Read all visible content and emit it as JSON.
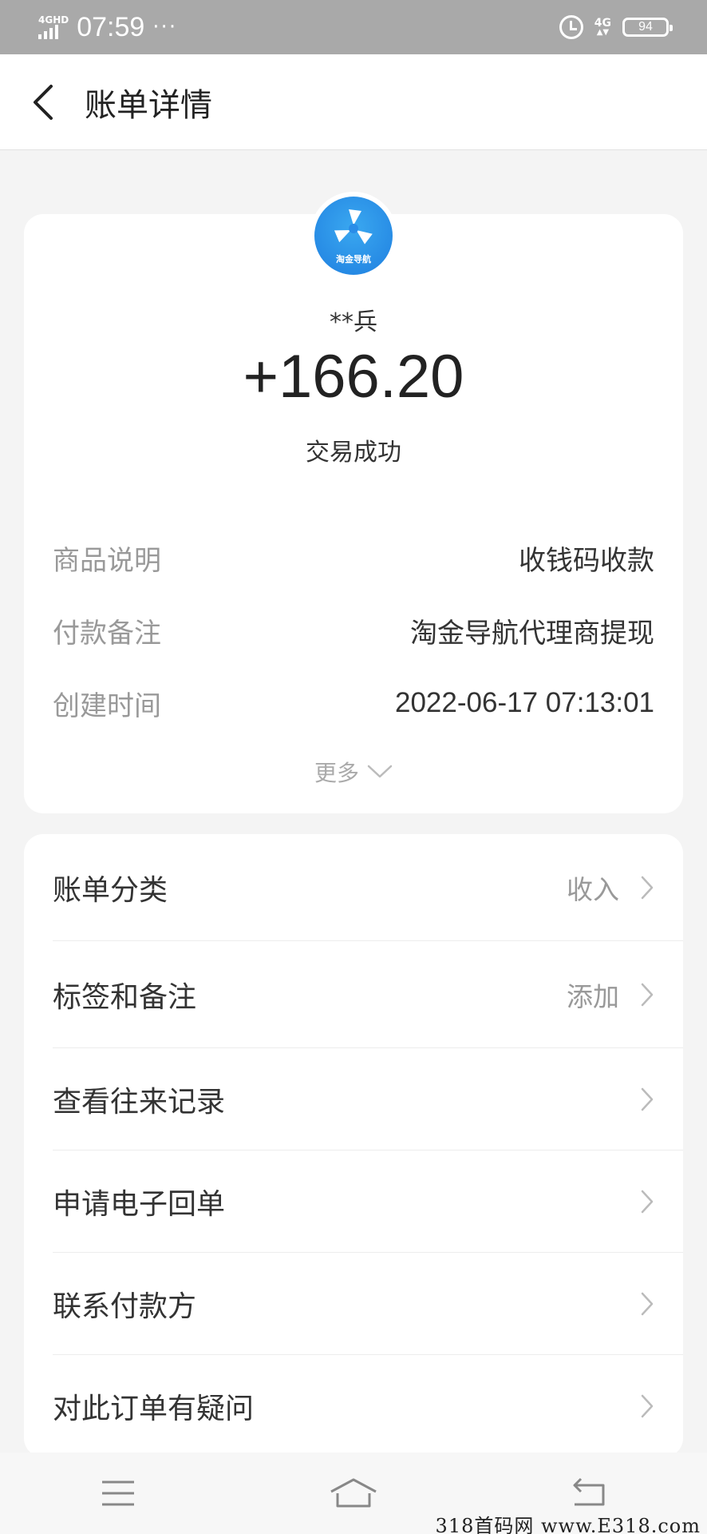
{
  "status_bar": {
    "network_label": "4GHD",
    "time": "07:59",
    "more": "···",
    "network_right": "4G",
    "battery": "94"
  },
  "header": {
    "title": "账单详情"
  },
  "transaction": {
    "merchant_logo_text": "淘金导航",
    "payer": "**兵",
    "amount": "+166.20",
    "status": "交易成功",
    "details": [
      {
        "label": "商品说明",
        "value": "收钱码收款"
      },
      {
        "label": "付款备注",
        "value": "淘金导航代理商提现"
      },
      {
        "label": "创建时间",
        "value": "2022-06-17 07:13:01"
      }
    ],
    "more_label": "更多"
  },
  "menu": [
    {
      "label": "账单分类",
      "value": "收入"
    },
    {
      "label": "标签和备注",
      "value": "添加"
    },
    {
      "label": "查看往来记录",
      "value": ""
    },
    {
      "label": "申请电子回单",
      "value": ""
    },
    {
      "label": "联系付款方",
      "value": ""
    },
    {
      "label": "对此订单有疑问",
      "value": ""
    }
  ],
  "watermark": "318首码网 www.E318.com"
}
